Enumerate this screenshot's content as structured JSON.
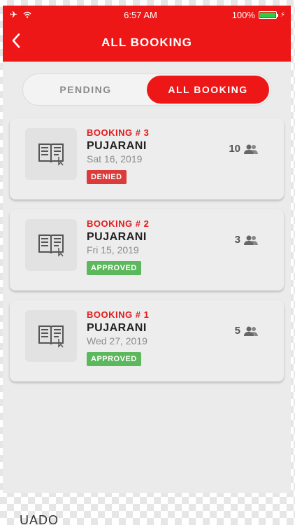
{
  "status_bar": {
    "time": "6:57 AM",
    "battery": "100%"
  },
  "header": {
    "title": "ALL BOOKING"
  },
  "tabs": {
    "pending": "PENDING",
    "all_booking": "ALL BOOKING"
  },
  "bookings": [
    {
      "number": "BOOKING # 3",
      "name": "PUJARANI",
      "date": "Sat 16, 2019",
      "status": "DENIED",
      "count": "10"
    },
    {
      "number": "BOOKING # 2",
      "name": "PUJARANI",
      "date": "Fri 15, 2019",
      "status": "APPROVED",
      "count": "3"
    },
    {
      "number": "BOOKING # 1",
      "name": "PUJARANI",
      "date": "Wed 27, 2019",
      "status": "APPROVED",
      "count": "5"
    }
  ],
  "footer_text": "UADO",
  "colors": {
    "brand": "#ee1717",
    "denied": "#dc3b3b",
    "approved": "#5cb85c"
  }
}
